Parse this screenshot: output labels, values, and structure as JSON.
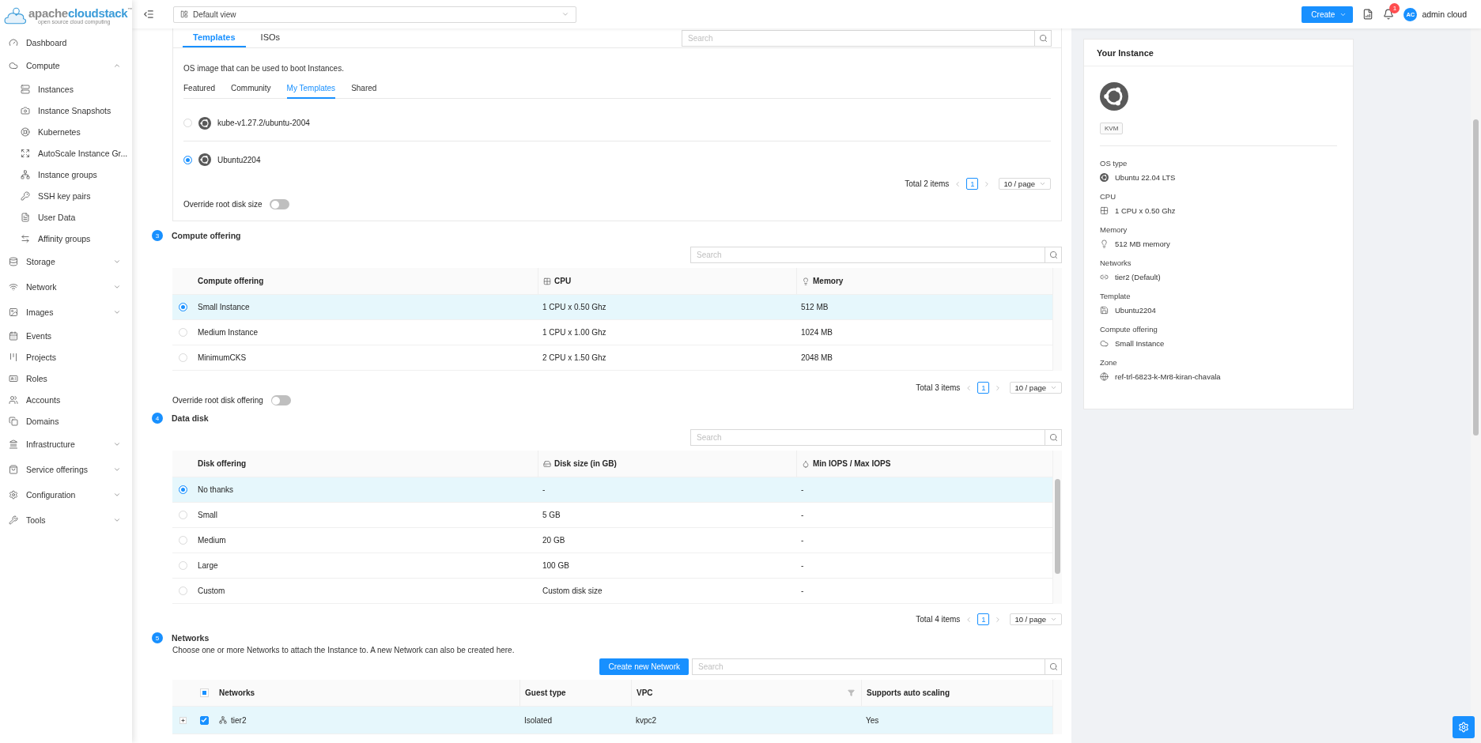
{
  "sidebar": {
    "logo": {
      "prefix": "apache",
      "main": "cloudstack",
      "mark": "™",
      "tagline": "open source cloud computing"
    },
    "items": [
      {
        "label": "Dashboard",
        "kind": "gauge"
      },
      {
        "label": "Compute",
        "kind": "cloud",
        "expanded": true,
        "children": [
          {
            "label": "Instances",
            "kind": "server"
          },
          {
            "label": "Instance Snapshots",
            "kind": "camera"
          },
          {
            "label": "Kubernetes",
            "kind": "helm"
          },
          {
            "label": "AutoScale Instance Gr...",
            "kind": "expand"
          },
          {
            "label": "Instance groups",
            "kind": "tree"
          },
          {
            "label": "SSH key pairs",
            "kind": "key"
          },
          {
            "label": "User Data",
            "kind": "file"
          },
          {
            "label": "Affinity groups",
            "kind": "swap"
          }
        ]
      },
      {
        "label": "Storage",
        "kind": "storage",
        "expanded": false
      },
      {
        "label": "Network",
        "kind": "wifi",
        "expanded": false
      },
      {
        "label": "Images",
        "kind": "image",
        "expanded": false
      },
      {
        "label": "Events",
        "kind": "calendar"
      },
      {
        "label": "Projects",
        "kind": "board"
      },
      {
        "label": "Roles",
        "kind": "idcard"
      },
      {
        "label": "Accounts",
        "kind": "users"
      },
      {
        "label": "Domains",
        "kind": "copy"
      },
      {
        "label": "Infrastructure",
        "kind": "bank",
        "expanded": false
      },
      {
        "label": "Service offerings",
        "kind": "bag",
        "expanded": false
      },
      {
        "label": "Configuration",
        "kind": "gear",
        "expanded": false
      },
      {
        "label": "Tools",
        "kind": "wrench",
        "expanded": false
      }
    ]
  },
  "header": {
    "view_select": "Default view",
    "create_button": "Create",
    "notification_count": "1",
    "avatar": "AC",
    "user": "admin cloud"
  },
  "template_section": {
    "tabs": [
      {
        "label": "Templates",
        "selected": true
      },
      {
        "label": "ISOs",
        "selected": false
      }
    ],
    "search": {
      "placeholder": "Search"
    },
    "description": "OS image that can be used to boot Instances.",
    "filters": [
      {
        "label": "Featured",
        "selected": false
      },
      {
        "label": "Community",
        "selected": false
      },
      {
        "label": "My Templates",
        "selected": true
      },
      {
        "label": "Shared",
        "selected": false
      }
    ],
    "templates": [
      {
        "name": "kube-v1.27.2/ubuntu-2004",
        "selected": false
      },
      {
        "name": "Ubuntu2204",
        "selected": true
      }
    ],
    "pagination": {
      "total": "Total 2 items",
      "page": "1",
      "page_size": "10 / page"
    },
    "override": {
      "label": "Override root disk size",
      "on": false
    }
  },
  "compute_offering": {
    "step": "3",
    "title": "Compute offering",
    "search": {
      "placeholder": "Search"
    },
    "columns": [
      {
        "label": "Compute offering",
        "kind": "plain"
      },
      {
        "label": "CPU",
        "kind": "cpu"
      },
      {
        "label": "Memory",
        "kind": "bulb"
      }
    ],
    "rows": [
      {
        "cells": [
          "Small Instance",
          "1 CPU x 0.50 Ghz",
          "512 MB"
        ],
        "selected": true
      },
      {
        "cells": [
          "Medium Instance",
          "1 CPU x 1.00 Ghz",
          "1024 MB"
        ],
        "selected": false
      },
      {
        "cells": [
          "MinimumCKS",
          "2 CPU x 1.50 Ghz",
          "2048 MB"
        ],
        "selected": false
      }
    ],
    "pagination": {
      "total": "Total 3 items",
      "page": "1",
      "page_size": "10 / page"
    },
    "override": {
      "label": "Override root disk offering",
      "on": false
    }
  },
  "data_disk": {
    "step": "4",
    "title": "Data disk",
    "search": {
      "placeholder": "Search"
    },
    "columns": [
      {
        "label": "Disk offering",
        "kind": "plain"
      },
      {
        "label": "Disk size (in GB)",
        "kind": "disk"
      },
      {
        "label": "Min IOPS / Max IOPS",
        "kind": "iops"
      }
    ],
    "rows": [
      {
        "cells": [
          "No thanks",
          "-",
          "-"
        ],
        "selected": true
      },
      {
        "cells": [
          "Small",
          "5 GB",
          "-"
        ],
        "selected": false
      },
      {
        "cells": [
          "Medium",
          "20 GB",
          "-"
        ],
        "selected": false
      },
      {
        "cells": [
          "Large",
          "100 GB",
          "-"
        ],
        "selected": false
      },
      {
        "cells": [
          "Custom",
          "Custom disk size",
          "-"
        ],
        "selected": false
      }
    ],
    "pagination": {
      "total": "Total 4 items",
      "page": "1",
      "page_size": "10 / page"
    }
  },
  "networks": {
    "step": "5",
    "title": "Networks",
    "description": "Choose one or more Networks to attach the Instance to. A new Network can also be created here.",
    "create_button": "Create new Network",
    "search": {
      "placeholder": "Search"
    },
    "select_all": {
      "indeterminate": true
    },
    "columns": [
      {
        "label": "Networks",
        "filter": false
      },
      {
        "label": "Guest type",
        "filter": false
      },
      {
        "label": "VPC",
        "filter": true
      },
      {
        "label": "Supports auto scaling",
        "filter": false
      }
    ],
    "rows": [
      {
        "cells": [
          "tier2",
          "Isolated",
          "kvpc2",
          "Yes"
        ],
        "selected": true,
        "expanded": false
      }
    ]
  },
  "instance_summary": {
    "title": "Your Instance",
    "hypervisor": "KVM",
    "details": [
      {
        "label": "OS type",
        "value": "Ubuntu 22.04 LTS",
        "kind": "ubuntu"
      },
      {
        "label": "CPU",
        "value": "1 CPU x 0.50 Ghz",
        "kind": "cpu"
      },
      {
        "label": "Memory",
        "value": "512 MB memory",
        "kind": "bulb"
      },
      {
        "label": "Networks",
        "value": "tier2 (Default)",
        "kind": "link"
      },
      {
        "label": "Template",
        "value": "Ubuntu2204",
        "kind": "save"
      },
      {
        "label": "Compute offering",
        "value": "Small Instance",
        "kind": "cloud"
      },
      {
        "label": "Zone",
        "value": "ref-trl-6823-k-Mr8-kiran-chavala",
        "kind": "globe"
      }
    ]
  }
}
